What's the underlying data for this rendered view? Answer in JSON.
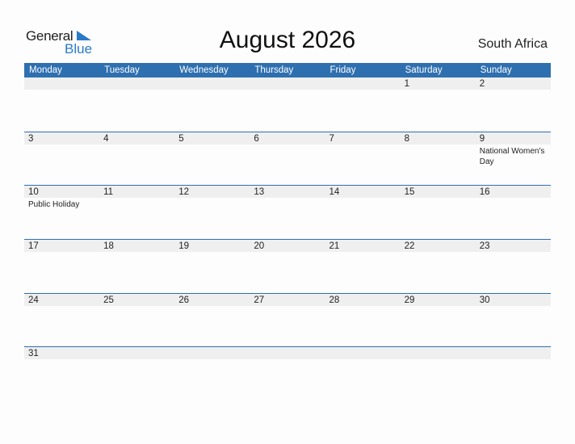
{
  "logo": {
    "word1": "General",
    "word2": "Blue"
  },
  "title": "August 2026",
  "country": "South Africa",
  "colors": {
    "accent": "#2e6fb0",
    "logo_blue": "#2a7ac7",
    "date_strip": "#efefef"
  },
  "weekdays": [
    "Monday",
    "Tuesday",
    "Wednesday",
    "Thursday",
    "Friday",
    "Saturday",
    "Sunday"
  ],
  "weeks": [
    [
      {
        "d": ""
      },
      {
        "d": ""
      },
      {
        "d": ""
      },
      {
        "d": ""
      },
      {
        "d": ""
      },
      {
        "d": "1"
      },
      {
        "d": "2"
      }
    ],
    [
      {
        "d": "3"
      },
      {
        "d": "4"
      },
      {
        "d": "5"
      },
      {
        "d": "6"
      },
      {
        "d": "7"
      },
      {
        "d": "8"
      },
      {
        "d": "9",
        "event": "National Women's Day"
      }
    ],
    [
      {
        "d": "10",
        "event": "Public Holiday"
      },
      {
        "d": "11"
      },
      {
        "d": "12"
      },
      {
        "d": "13"
      },
      {
        "d": "14"
      },
      {
        "d": "15"
      },
      {
        "d": "16"
      }
    ],
    [
      {
        "d": "17"
      },
      {
        "d": "18"
      },
      {
        "d": "19"
      },
      {
        "d": "20"
      },
      {
        "d": "21"
      },
      {
        "d": "22"
      },
      {
        "d": "23"
      }
    ],
    [
      {
        "d": "24"
      },
      {
        "d": "25"
      },
      {
        "d": "26"
      },
      {
        "d": "27"
      },
      {
        "d": "28"
      },
      {
        "d": "29"
      },
      {
        "d": "30"
      }
    ],
    [
      {
        "d": "31"
      },
      {
        "d": ""
      },
      {
        "d": ""
      },
      {
        "d": ""
      },
      {
        "d": ""
      },
      {
        "d": ""
      },
      {
        "d": ""
      }
    ]
  ]
}
